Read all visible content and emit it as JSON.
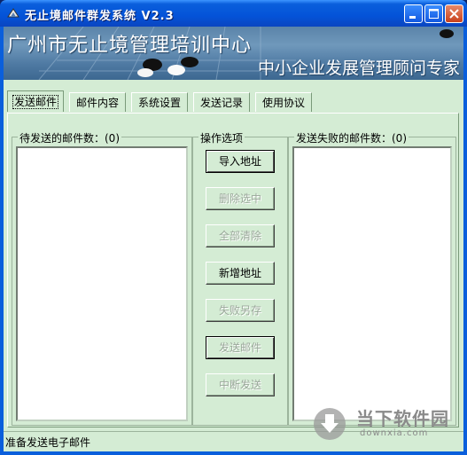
{
  "window": {
    "title": "无止境邮件群发系统  V2.3"
  },
  "banner": {
    "title": "广州市无止境管理培训中心",
    "subtitle": "中小企业发展管理顾问专家"
  },
  "tabs": [
    {
      "label": "发送邮件",
      "active": true
    },
    {
      "label": "邮件内容",
      "active": false
    },
    {
      "label": "系统设置",
      "active": false
    },
    {
      "label": "发送记录",
      "active": false
    },
    {
      "label": "使用协议",
      "active": false
    }
  ],
  "pending_group": {
    "label": "待发送的邮件数：(0)"
  },
  "operations_group": {
    "label": "操作选项",
    "buttons": [
      {
        "label": "导入地址",
        "enabled": true
      },
      {
        "label": "删除选中",
        "enabled": false
      },
      {
        "label": "全部清除",
        "enabled": false
      },
      {
        "label": "新增地址",
        "enabled": true
      },
      {
        "label": "失败另存",
        "enabled": false
      },
      {
        "label": "发送邮件",
        "enabled": false
      },
      {
        "label": "中断发送",
        "enabled": false
      }
    ]
  },
  "failed_group": {
    "label": "发送失败的邮件数：(0)"
  },
  "status": {
    "text": "准备发送电子邮件"
  },
  "watermark": {
    "cn": "当下软件园",
    "en": "downxia.com"
  },
  "colors": {
    "client_bg": "#d4ecd4",
    "titlebar": "#0453d8"
  }
}
